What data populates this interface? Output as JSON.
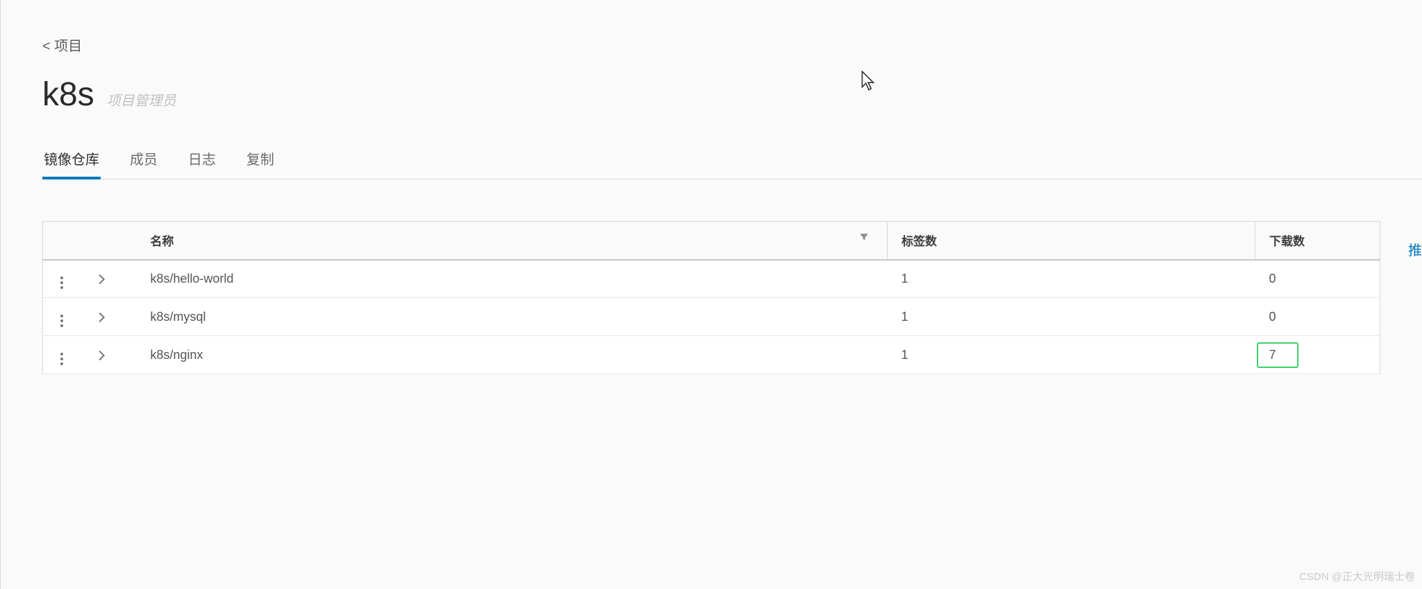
{
  "breadcrumb": {
    "back": "< 项目"
  },
  "project": {
    "name": "k8s",
    "role": "项目管理员"
  },
  "tabs": [
    {
      "id": "repos",
      "label": "镜像仓库",
      "active": true
    },
    {
      "id": "members",
      "label": "成员",
      "active": false
    },
    {
      "id": "logs",
      "label": "日志",
      "active": false
    },
    {
      "id": "replication",
      "label": "复制",
      "active": false
    }
  ],
  "actions": {
    "push": "推"
  },
  "table": {
    "columns": {
      "name": "名称",
      "tags": "标签数",
      "pulls": "下载数"
    },
    "rows": [
      {
        "name": "k8s/hello-world",
        "tags": "1",
        "pulls": "0",
        "highlight": false
      },
      {
        "name": "k8s/mysql",
        "tags": "1",
        "pulls": "0",
        "highlight": false
      },
      {
        "name": "k8s/nginx",
        "tags": "1",
        "pulls": "7",
        "highlight": true
      }
    ]
  },
  "watermark": "CSDN @正大光明瑞士卷"
}
